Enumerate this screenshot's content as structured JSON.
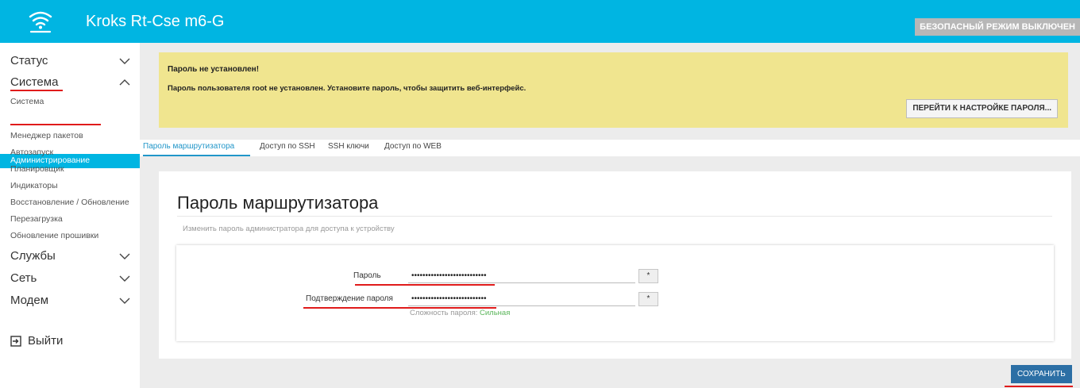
{
  "header": {
    "brand": "Kroks Rt-Cse m6-G",
    "safe_mode": "БЕЗОПАСНЫЙ РЕЖИМ ВЫКЛЮЧЕН",
    "logo_icon": "wifi-logo-icon"
  },
  "sidebar": {
    "status": "Статус",
    "system": "Система",
    "sub_items": [
      "Система",
      "Администрирование",
      "Менеджер пакетов",
      "Автозапуск",
      "Планировщик",
      "Индикаторы",
      "Восстановление / Обновление",
      "Перезагрузка",
      "Обновление прошивки"
    ],
    "services": "Службы",
    "network": "Сеть",
    "modem": "Модем",
    "logout": "Выйти"
  },
  "alert": {
    "title": "Пароль не установлен!",
    "text": "Пароль пользователя root не установлен. Установите пароль, чтобы защитить веб-интерфейс.",
    "button": "ПЕРЕЙТИ К НАСТРОЙКЕ ПАРОЛЯ..."
  },
  "tabs": [
    "Пароль маршрутизатора",
    "Доступ по SSH",
    "SSH ключи",
    "Доступ по WEB"
  ],
  "card": {
    "title": "Пароль маршрутизатора",
    "description": "Изменить пароль администратора для доступа к устройству",
    "password_label": "Пароль",
    "password_value": "•••••••••••••••••••••••••••",
    "confirm_label": "Подтверждение пароля",
    "confirm_value": "•••••••••••••••••••••••••••",
    "reveal": "*",
    "strength_label": "Сложность пароля:",
    "strength_value": "Сильная"
  },
  "save_button": "СОХРАНИТЬ",
  "colors": {
    "accent": "#00b5e2",
    "alert_bg": "#f0e58f",
    "save_bg": "#2c6fa5",
    "annotation_red": "#e01b1b",
    "strength_good": "#5ab55a"
  }
}
